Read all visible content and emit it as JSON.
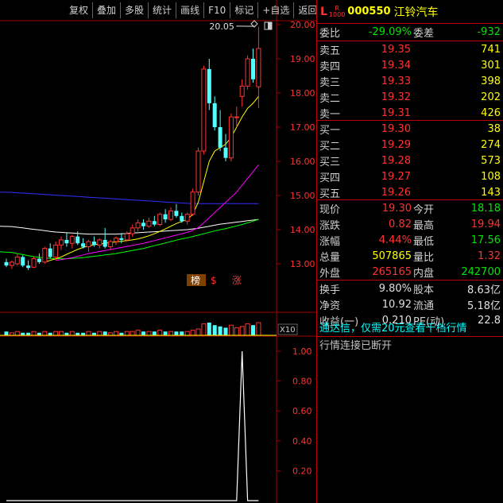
{
  "toolbar": [
    "复权",
    "叠加",
    "多股",
    "统计",
    "画线",
    "F10",
    "标记",
    "+自选",
    "返回"
  ],
  "stock": {
    "prefix_l": "L",
    "prefix_r_top": "R",
    "prefix_r_bottom": "1000",
    "code": "000550",
    "name": "江铃汽车"
  },
  "weibi": {
    "label": "委比",
    "value": "-29.09%",
    "label2": "委差",
    "value2": "-932"
  },
  "sell": [
    {
      "label": "卖五",
      "price": "19.35",
      "volume": "741"
    },
    {
      "label": "卖四",
      "price": "19.34",
      "volume": "301"
    },
    {
      "label": "卖三",
      "price": "19.33",
      "volume": "398"
    },
    {
      "label": "卖二",
      "price": "19.32",
      "volume": "202"
    },
    {
      "label": "卖一",
      "price": "19.31",
      "volume": "426"
    }
  ],
  "buy": [
    {
      "label": "买一",
      "price": "19.30",
      "volume": "38"
    },
    {
      "label": "买二",
      "price": "19.29",
      "volume": "274"
    },
    {
      "label": "买三",
      "price": "19.28",
      "volume": "573"
    },
    {
      "label": "买四",
      "price": "19.27",
      "volume": "108"
    },
    {
      "label": "买五",
      "price": "19.26",
      "volume": "143"
    }
  ],
  "quote": [
    {
      "l1": "现价",
      "v1": "19.30",
      "c1": "red",
      "l2": "今开",
      "v2": "18.18",
      "c2": "green"
    },
    {
      "l1": "涨跌",
      "v1": "0.82",
      "c1": "red",
      "l2": "最高",
      "v2": "19.94",
      "c2": "red"
    },
    {
      "l1": "涨幅",
      "v1": "4.44%",
      "c1": "red",
      "l2": "最低",
      "v2": "17.56",
      "c2": "green"
    },
    {
      "l1": "总量",
      "v1": "507865",
      "c1": "yellow",
      "l2": "量比",
      "v2": "1.32",
      "c2": "red"
    },
    {
      "l1": "外盘",
      "v1": "265165",
      "c1": "red",
      "l2": "内盘",
      "v2": "242700",
      "c2": "green"
    }
  ],
  "fundamentals": [
    {
      "l1": "换手",
      "v1": "9.80%",
      "l2": "股本",
      "v2": "8.63亿"
    },
    {
      "l1": "净资",
      "v1": "10.92",
      "l2": "流通",
      "v2": "5.18亿"
    },
    {
      "l1": "收益(一)",
      "v1": "0.210",
      "l2": "PE(动)",
      "v2": "22.8"
    }
  ],
  "messages": {
    "promo": "通达信，仅需20元查看千档行情",
    "status": "行情连接已断开"
  },
  "colors": {
    "up": "#ff3232",
    "down": "#54ffff",
    "ma_white": "#ffffff",
    "ma_yellow": "#ffff00",
    "ma_magenta": "#ff00ff",
    "ma_green": "#00ff00",
    "ma_blue": "#3030ff",
    "grid_red": "#a00000"
  },
  "markers": {
    "bang": "榜",
    "dollar": "$",
    "zhang": "涨"
  },
  "volume_scale": "X10",
  "chart_data": [
    {
      "type": "candlestick",
      "y_ticks": [
        "20.00",
        "19.00",
        "18.00",
        "17.00",
        "16.00",
        "15.00",
        "14.00",
        "13.00"
      ],
      "ylim": [
        12.65,
        20.4
      ],
      "max_label": "20.05",
      "candles": [
        {
          "o": 13.05,
          "h": 13.15,
          "l": 12.9,
          "c": 12.95
        },
        {
          "o": 12.95,
          "h": 13.1,
          "l": 12.85,
          "c": 13.05
        },
        {
          "o": 13.0,
          "h": 13.3,
          "l": 12.95,
          "c": 13.2
        },
        {
          "o": 13.2,
          "h": 13.25,
          "l": 12.9,
          "c": 12.95
        },
        {
          "o": 12.95,
          "h": 13.1,
          "l": 12.82,
          "c": 12.88
        },
        {
          "o": 12.9,
          "h": 13.2,
          "l": 12.88,
          "c": 13.15
        },
        {
          "o": 13.15,
          "h": 13.3,
          "l": 13.0,
          "c": 13.05
        },
        {
          "o": 13.05,
          "h": 13.5,
          "l": 13.0,
          "c": 13.45
        },
        {
          "o": 13.45,
          "h": 13.6,
          "l": 13.15,
          "c": 13.2
        },
        {
          "o": 13.2,
          "h": 13.65,
          "l": 13.1,
          "c": 13.55
        },
        {
          "o": 13.55,
          "h": 13.8,
          "l": 13.4,
          "c": 13.7
        },
        {
          "o": 13.7,
          "h": 13.9,
          "l": 13.5,
          "c": 13.6
        },
        {
          "o": 13.6,
          "h": 13.85,
          "l": 13.45,
          "c": 13.8
        },
        {
          "o": 13.8,
          "h": 13.95,
          "l": 13.55,
          "c": 13.6
        },
        {
          "o": 13.6,
          "h": 13.75,
          "l": 13.45,
          "c": 13.5
        },
        {
          "o": 13.5,
          "h": 13.7,
          "l": 13.35,
          "c": 13.65
        },
        {
          "o": 13.65,
          "h": 13.8,
          "l": 13.5,
          "c": 13.55
        },
        {
          "o": 13.55,
          "h": 13.75,
          "l": 13.45,
          "c": 13.7
        },
        {
          "o": 13.7,
          "h": 14.05,
          "l": 13.45,
          "c": 13.5
        },
        {
          "o": 13.5,
          "h": 13.7,
          "l": 13.4,
          "c": 13.65
        },
        {
          "o": 13.65,
          "h": 13.8,
          "l": 13.55,
          "c": 13.75
        },
        {
          "o": 13.75,
          "h": 13.9,
          "l": 13.6,
          "c": 13.7
        },
        {
          "o": 13.7,
          "h": 13.95,
          "l": 13.65,
          "c": 13.88
        },
        {
          "o": 13.88,
          "h": 14.15,
          "l": 13.8,
          "c": 14.05
        },
        {
          "o": 14.05,
          "h": 14.3,
          "l": 13.95,
          "c": 14.2
        },
        {
          "o": 14.2,
          "h": 14.3,
          "l": 14.0,
          "c": 14.1
        },
        {
          "o": 14.1,
          "h": 14.35,
          "l": 14.05,
          "c": 14.25
        },
        {
          "o": 14.25,
          "h": 14.4,
          "l": 14.1,
          "c": 14.15
        },
        {
          "o": 14.15,
          "h": 14.5,
          "l": 14.1,
          "c": 14.45
        },
        {
          "o": 14.45,
          "h": 14.6,
          "l": 14.2,
          "c": 14.3
        },
        {
          "o": 14.3,
          "h": 14.65,
          "l": 14.25,
          "c": 14.55
        },
        {
          "o": 14.55,
          "h": 14.75,
          "l": 14.35,
          "c": 14.4
        },
        {
          "o": 14.4,
          "h": 14.5,
          "l": 14.2,
          "c": 14.25
        },
        {
          "o": 14.25,
          "h": 14.5,
          "l": 14.15,
          "c": 14.45
        },
        {
          "o": 14.45,
          "h": 15.2,
          "l": 14.4,
          "c": 15.1
        },
        {
          "o": 15.1,
          "h": 16.4,
          "l": 15.0,
          "c": 16.3
        },
        {
          "o": 16.3,
          "h": 18.8,
          "l": 16.2,
          "c": 18.7
        },
        {
          "o": 18.7,
          "h": 19.0,
          "l": 17.5,
          "c": 17.7
        },
        {
          "o": 17.7,
          "h": 17.9,
          "l": 16.9,
          "c": 17.0
        },
        {
          "o": 17.0,
          "h": 17.5,
          "l": 16.3,
          "c": 16.4
        },
        {
          "o": 16.4,
          "h": 16.8,
          "l": 16.0,
          "c": 16.1
        },
        {
          "o": 16.1,
          "h": 17.4,
          "l": 16.0,
          "c": 17.3
        },
        {
          "o": 17.3,
          "h": 17.6,
          "l": 17.0,
          "c": 17.3
        },
        {
          "o": 17.9,
          "h": 18.4,
          "l": 17.6,
          "c": 18.2
        },
        {
          "o": 18.2,
          "h": 19.1,
          "l": 18.1,
          "c": 19.0
        },
        {
          "o": 19.0,
          "h": 19.3,
          "l": 18.3,
          "c": 18.4
        },
        {
          "o": 18.18,
          "h": 19.94,
          "l": 17.56,
          "c": 19.3
        }
      ],
      "ma_lines": [
        {
          "color_key": "ma_blue",
          "values": [
            15.1,
            15.09,
            15.08,
            15.07,
            15.06,
            15.05,
            15.04,
            15.03,
            15.02,
            15.01,
            15.0,
            14.99,
            14.98,
            14.97,
            14.96,
            14.95,
            14.94,
            14.93,
            14.92,
            14.91,
            14.9,
            14.89,
            14.88,
            14.87,
            14.86,
            14.85,
            14.84,
            14.83,
            14.82,
            14.81,
            14.8,
            14.79,
            14.78,
            14.77,
            14.76,
            14.76,
            14.76,
            14.76,
            14.76,
            14.76,
            14.76,
            14.76,
            14.76,
            14.76,
            14.76,
            14.76,
            14.76
          ]
        },
        {
          "color_key": "ma_white",
          "values": [
            14.1,
            14.09,
            14.07,
            14.05,
            14.03,
            14.01,
            13.99,
            13.97,
            13.95,
            13.93,
            13.92,
            13.91,
            13.9,
            13.89,
            13.88,
            13.87,
            13.87,
            13.87,
            13.87,
            13.87,
            13.87,
            13.88,
            13.89,
            13.9,
            13.91,
            13.92,
            13.93,
            13.94,
            13.95,
            13.96,
            13.97,
            13.98,
            13.99,
            14.0,
            14.02,
            14.04,
            14.07,
            14.1,
            14.13,
            14.16,
            14.18,
            14.2,
            14.22,
            14.24,
            14.26,
            14.28,
            14.3
          ]
        },
        {
          "color_key": "ma_green",
          "values": [
            13.35,
            13.33,
            13.3,
            13.27,
            13.24,
            13.21,
            13.19,
            13.17,
            13.16,
            13.15,
            13.15,
            13.15,
            13.16,
            13.17,
            13.18,
            13.2,
            13.22,
            13.24,
            13.26,
            13.28,
            13.3,
            13.33,
            13.36,
            13.39,
            13.42,
            13.45,
            13.49,
            13.53,
            13.57,
            13.61,
            13.65,
            13.69,
            13.73,
            13.76,
            13.8,
            13.84,
            13.88,
            13.92,
            13.96,
            14.0,
            14.03,
            14.07,
            14.11,
            14.15,
            14.2,
            14.25,
            14.3
          ]
        },
        {
          "color_key": "ma_magenta",
          "values": [
            null,
            null,
            null,
            null,
            null,
            null,
            null,
            null,
            null,
            13.1,
            13.12,
            13.15,
            13.18,
            13.22,
            13.26,
            13.3,
            13.33,
            13.36,
            13.39,
            13.42,
            13.45,
            13.48,
            13.51,
            13.54,
            13.57,
            13.6,
            13.64,
            13.68,
            13.72,
            13.76,
            13.8,
            13.84,
            13.88,
            13.92,
            13.98,
            14.06,
            14.2,
            14.35,
            14.5,
            14.65,
            14.8,
            14.95,
            15.1,
            15.3,
            15.5,
            15.7,
            15.9
          ]
        },
        {
          "color_key": "ma_yellow",
          "values": [
            null,
            null,
            null,
            null,
            null,
            null,
            null,
            13.05,
            13.1,
            13.15,
            13.2,
            13.28,
            13.35,
            13.42,
            13.48,
            13.52,
            13.56,
            13.58,
            13.6,
            13.62,
            13.64,
            13.66,
            13.68,
            13.7,
            13.73,
            13.77,
            13.82,
            13.88,
            13.95,
            14.02,
            14.1,
            14.18,
            14.24,
            14.3,
            14.45,
            14.8,
            15.4,
            16.0,
            16.3,
            16.4,
            16.5,
            16.7,
            17.0,
            17.3,
            17.55,
            17.7,
            17.9
          ]
        }
      ]
    },
    {
      "type": "bar",
      "volumes": [
        3,
        2,
        3,
        2,
        2,
        3,
        2,
        3,
        2,
        3,
        3,
        2,
        3,
        2,
        2,
        3,
        2,
        3,
        3,
        2,
        3,
        2,
        3,
        3,
        4,
        3,
        3,
        3,
        4,
        3,
        3,
        3,
        3,
        3,
        4,
        5,
        9,
        10,
        8,
        7,
        6,
        8,
        6,
        7,
        9,
        8,
        10
      ]
    },
    {
      "type": "line",
      "y_ticks": [
        "1.00",
        "0.80",
        "0.60",
        "0.40",
        "0.20"
      ],
      "ylim": [
        0,
        1.0
      ],
      "values": [
        0,
        0,
        0,
        0,
        0,
        0,
        0,
        0,
        0,
        0,
        0,
        0,
        0,
        0,
        0,
        0,
        0,
        0,
        0,
        0,
        0,
        0,
        0,
        0,
        0,
        0,
        0,
        0,
        0,
        0,
        0,
        0,
        0,
        0,
        0,
        0,
        0,
        0,
        0,
        0,
        0,
        0,
        0,
        1.0,
        0,
        0,
        0
      ]
    }
  ]
}
